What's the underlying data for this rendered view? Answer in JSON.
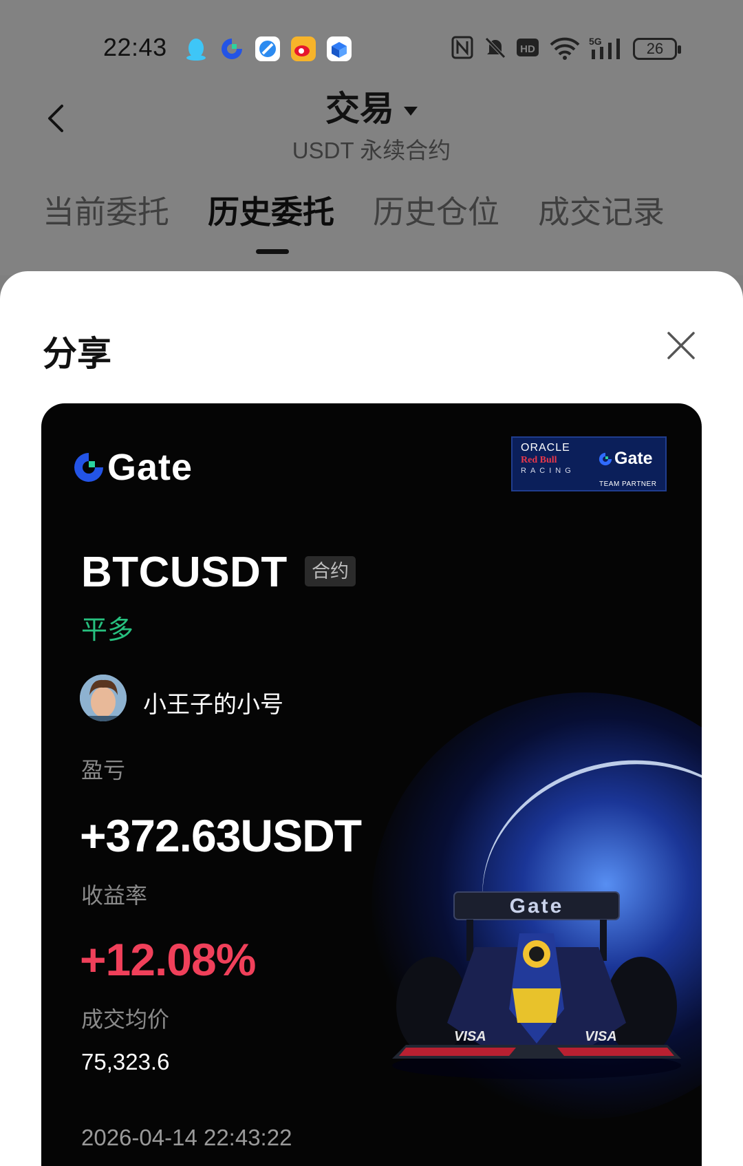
{
  "status_bar": {
    "time": "22:43",
    "app_icons": [
      "qq-icon",
      "gate-app-icon",
      "browser-icon",
      "weibo-icon",
      "box-app-icon"
    ],
    "system_icons": [
      "nfc-icon",
      "mute-icon",
      "hd-icon",
      "wifi-icon",
      "5g-signal-icon"
    ],
    "battery": "26"
  },
  "header": {
    "title": "交易",
    "subtitle": "USDT 永续合约"
  },
  "tabs": [
    {
      "label": "当前委托",
      "active": false
    },
    {
      "label": "历史委托",
      "active": true
    },
    {
      "label": "历史仓位",
      "active": false
    },
    {
      "label": "成交记录",
      "active": false
    }
  ],
  "share_sheet": {
    "title": "分享"
  },
  "card": {
    "brand": "Gate",
    "partner_badge": {
      "line1": "ORACLE",
      "line2": "Red Bull",
      "line3": "RACING",
      "brand": "Gate",
      "caption": "TEAM PARTNER"
    },
    "symbol": "BTCUSDT",
    "contract_tag": "合约",
    "side": "平多",
    "username": "小王子的小号",
    "pnl_label": "盈亏",
    "pnl_value": "+372.63USDT",
    "roi_label": "收益率",
    "roi_value": "+12.08%",
    "avg_price_label": "成交均价",
    "avg_price_value": "75,323.6",
    "timestamp": "2026-04-14 22:43:22"
  },
  "colors": {
    "gate_blue": "#2354e6",
    "long_green": "#27c07f",
    "profit_red": "#f0405a"
  }
}
